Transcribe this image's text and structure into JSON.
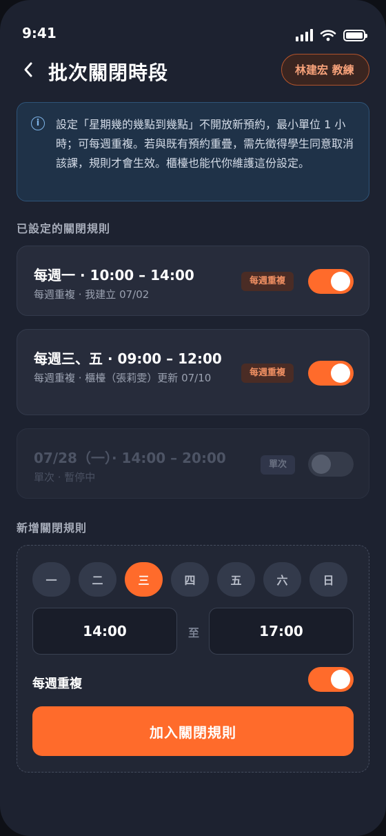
{
  "status_bar": {
    "time": "9:41"
  },
  "header": {
    "title": "批次關閉時段",
    "coach_name": "林建宏 教練"
  },
  "info": {
    "text": "設定「星期幾的幾點到幾點」不開放新預約，最小單位 1 小時；可每週重複。若與既有預約重疊，需先徵得學生同意取消該課，規則才會生效。櫃檯也能代你維護這份設定。"
  },
  "rules_section_label": "已設定的關閉規則",
  "rules": [
    {
      "title": "每週一 · 10:00 – 14:00",
      "subtitle": "每週重複 · 我建立 07/02",
      "tag": "每週重複",
      "enabled": true
    },
    {
      "title": "每週三、五 · 09:00 – 12:00",
      "subtitle": "每週重複 · 櫃檯（張莉雯）更新 07/10",
      "tag": "每週重複",
      "enabled": true
    },
    {
      "title": "07/28（一）· 14:00 – 20:00",
      "subtitle": "單次 · 暫停中",
      "tag": "單次",
      "enabled": false
    }
  ],
  "new_section_label": "新增關閉規則",
  "new_rule": {
    "days": [
      "一",
      "二",
      "三",
      "四",
      "五",
      "六",
      "日"
    ],
    "selected_day": "三",
    "start_time": "14:00",
    "to_label": "至",
    "end_time": "17:00",
    "repeat_label": "每週重複",
    "repeat_enabled": true,
    "add_button_label": "加入關閉規則"
  },
  "colors": {
    "accent": "#ff6b2b",
    "background": "#1d2230",
    "card": "#272c3b",
    "info_bg": "#1f3248"
  }
}
